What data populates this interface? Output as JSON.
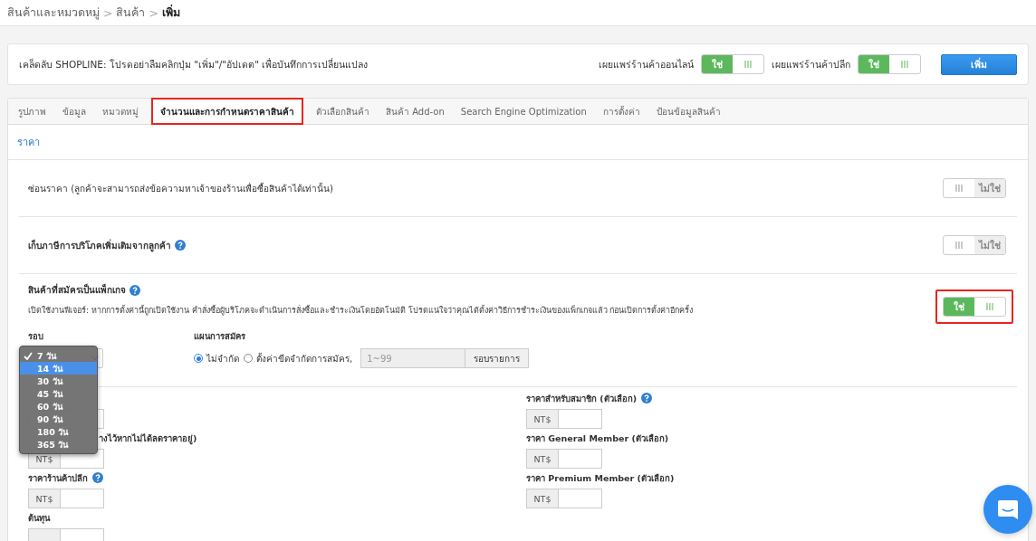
{
  "breadcrumb": [
    {
      "label": "สินค้าและหมวดหมู่",
      "current": false
    },
    {
      "label": "สินค้า",
      "current": false,
      "separator": ">"
    },
    {
      "label": "เพิ่ม",
      "current": true,
      "separator": ">"
    }
  ],
  "tip": "เคล็ดลับ SHOPLINE: โปรดอย่าลืมคลิกปุ่ม \"เพิ่ม\"/\"อัปเดต\" เพื่อบันทึกการเปลี่ยนแปลง",
  "publish": [
    {
      "label": "เผยแพร่ร้านค้าออนไลน์",
      "toggle": {
        "on": true,
        "label": "ใช่",
        "grip": "III"
      }
    },
    {
      "label": "เผยแพร่ร้านค้าปลีก",
      "toggle": {
        "on": true,
        "label": "ใช่",
        "grip": "III"
      }
    }
  ],
  "add_button": "เพิ่ม",
  "tabs": [
    {
      "label": "รูปภาพ",
      "selected": false,
      "highlighted": false
    },
    {
      "label": "ข้อมูล",
      "selected": false,
      "highlighted": false
    },
    {
      "label": "หมวดหมู่",
      "selected": false,
      "highlighted": false
    },
    {
      "label": "จำนวนและการกำหนดราคาสินค้า",
      "selected": true,
      "highlighted": true
    },
    {
      "label": "ตัวเลือกสินค้า",
      "selected": false,
      "highlighted": false
    },
    {
      "label": "สินค้า Add-on",
      "selected": false,
      "highlighted": false
    },
    {
      "label": "Search Engine Optimization",
      "selected": false,
      "highlighted": false
    },
    {
      "label": "การตั้งค่า",
      "selected": false,
      "highlighted": false
    },
    {
      "label": "ป้อนข้อมูลสินค้า",
      "selected": false,
      "highlighted": false
    }
  ],
  "section_title": "ราคา",
  "settings": [
    {
      "kind": "toggle",
      "title": "ซ่อนราคา (ลูกค้าจะสามารถส่งข้อความหาเจ้าของร้านเพื่อซื้อสินค้าได้เท่านั้น)",
      "bold": false,
      "help": false,
      "toggle": {
        "on": false,
        "label": "ไม่ใช่",
        "grip": "III"
      }
    },
    {
      "kind": "toggle",
      "title": "เก็บภาษีการบริโภคเพิ่มเติมจากลูกค้า",
      "bold": true,
      "help": true,
      "toggle": {
        "on": false,
        "label": "ไม่ใช่",
        "grip": "III"
      }
    },
    {
      "kind": "subscription",
      "title": "สินค้าที่สมัครเป็นแพ็กเกจ",
      "bold": true,
      "help": true,
      "description": "เปิดใช้งานฟีเจอร์: หากการตั้งค่านี้ถูกเปิดใช้งาน คำสั่งซื้อผู้บริโภคจะดำเนินการสั่งซื้อและชำระเงินโดยอัตโนมัติ โปรดแน่ใจว่าคุณได้ตั้งค่าวิธีการชำระเงินของแพ็กเกจแล้ว ก่อนเปิดการตั้งค่าอีกครั้ง",
      "toggle": {
        "on": true,
        "label": "ใช่",
        "grip": "III",
        "highlighted": true
      },
      "cycle": {
        "label": "รอบ",
        "options": [
          {
            "label": "7 วัน",
            "checked": true,
            "highlighted": false
          },
          {
            "label": "14 วัน",
            "checked": false,
            "highlighted": true
          },
          {
            "label": "30 วัน",
            "checked": false,
            "highlighted": false
          },
          {
            "label": "45 วัน",
            "checked": false,
            "highlighted": false
          },
          {
            "label": "60 วัน",
            "checked": false,
            "highlighted": false
          },
          {
            "label": "90 วัน",
            "checked": false,
            "highlighted": false
          },
          {
            "label": "180 วัน",
            "checked": false,
            "highlighted": false
          },
          {
            "label": "365 วัน",
            "checked": false,
            "highlighted": false
          }
        ]
      },
      "plan": {
        "label": "แผนการสมัคร",
        "options": [
          {
            "label": "ไม่จำกัด",
            "selected": true
          },
          {
            "label": "ตั้งค่าขีดจำกัดการสมัคร,",
            "selected": false
          }
        ],
        "limit_placeholder": "1~99",
        "unit": "รอบรายการ"
      }
    }
  ],
  "price_fields": {
    "left": [
      {
        "kind": "covered"
      },
      {
        "kind": "clipped",
        "label": "างไว้หากไม่ได้ลดราคาอยู่)",
        "help": false,
        "prefix": "NT$"
      },
      {
        "kind": "field",
        "label": "ราคาร้านค้าปลีก",
        "help": true,
        "prefix": "NT$"
      },
      {
        "kind": "cut",
        "label": "ต้นทุน",
        "help": false
      }
    ],
    "right": [
      {
        "kind": "field",
        "label": "ราคาสำหรับสมาชิก (ตัวเลือก)",
        "help": true,
        "prefix": "NT$"
      },
      {
        "kind": "field",
        "label": "ราคา General Member (ตัวเลือก)",
        "help": false,
        "prefix": "NT$"
      },
      {
        "kind": "field",
        "label": "ราคา Premium Member (ตัวเลือก)",
        "help": false,
        "prefix": "NT$"
      }
    ]
  }
}
